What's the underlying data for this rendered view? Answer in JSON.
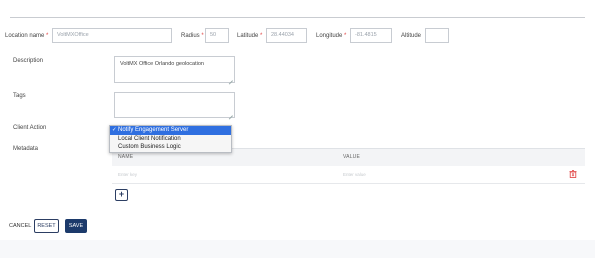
{
  "location": {
    "name_label": "Location name",
    "name_value": "VoltMXOffice",
    "radius_label": "Radius",
    "radius_value": "50",
    "latitude_label": "Latitude",
    "latitude_value": "28.44034",
    "longitude_label": "Longitude",
    "longitude_value": "-81.4815",
    "altitude_label": "Altitude",
    "altitude_value": "",
    "required_mark": "*"
  },
  "description": {
    "label": "Description",
    "value": "VoltMX Office Orlando geolocation"
  },
  "tags": {
    "label": "Tags",
    "value": ""
  },
  "client_action": {
    "label": "Client Action",
    "options": [
      "Notify Engagement Server",
      "Local Client Notification",
      "Custom Business Logic"
    ],
    "selected_check": "✓"
  },
  "metadata": {
    "label": "Metadata",
    "columns": [
      "NAME",
      "VALUE"
    ],
    "name_placeholder": "Enter key",
    "value_placeholder": "Enter value",
    "add_label": "+"
  },
  "actions": {
    "cancel_label": "CANCEL",
    "reset_label": "RESET",
    "save_label": "SAVE"
  },
  "colors": {
    "accent": "#1c3a6b",
    "selection": "#2f6fe0",
    "required": "#e03c3c",
    "delete": "#e03c3c"
  }
}
